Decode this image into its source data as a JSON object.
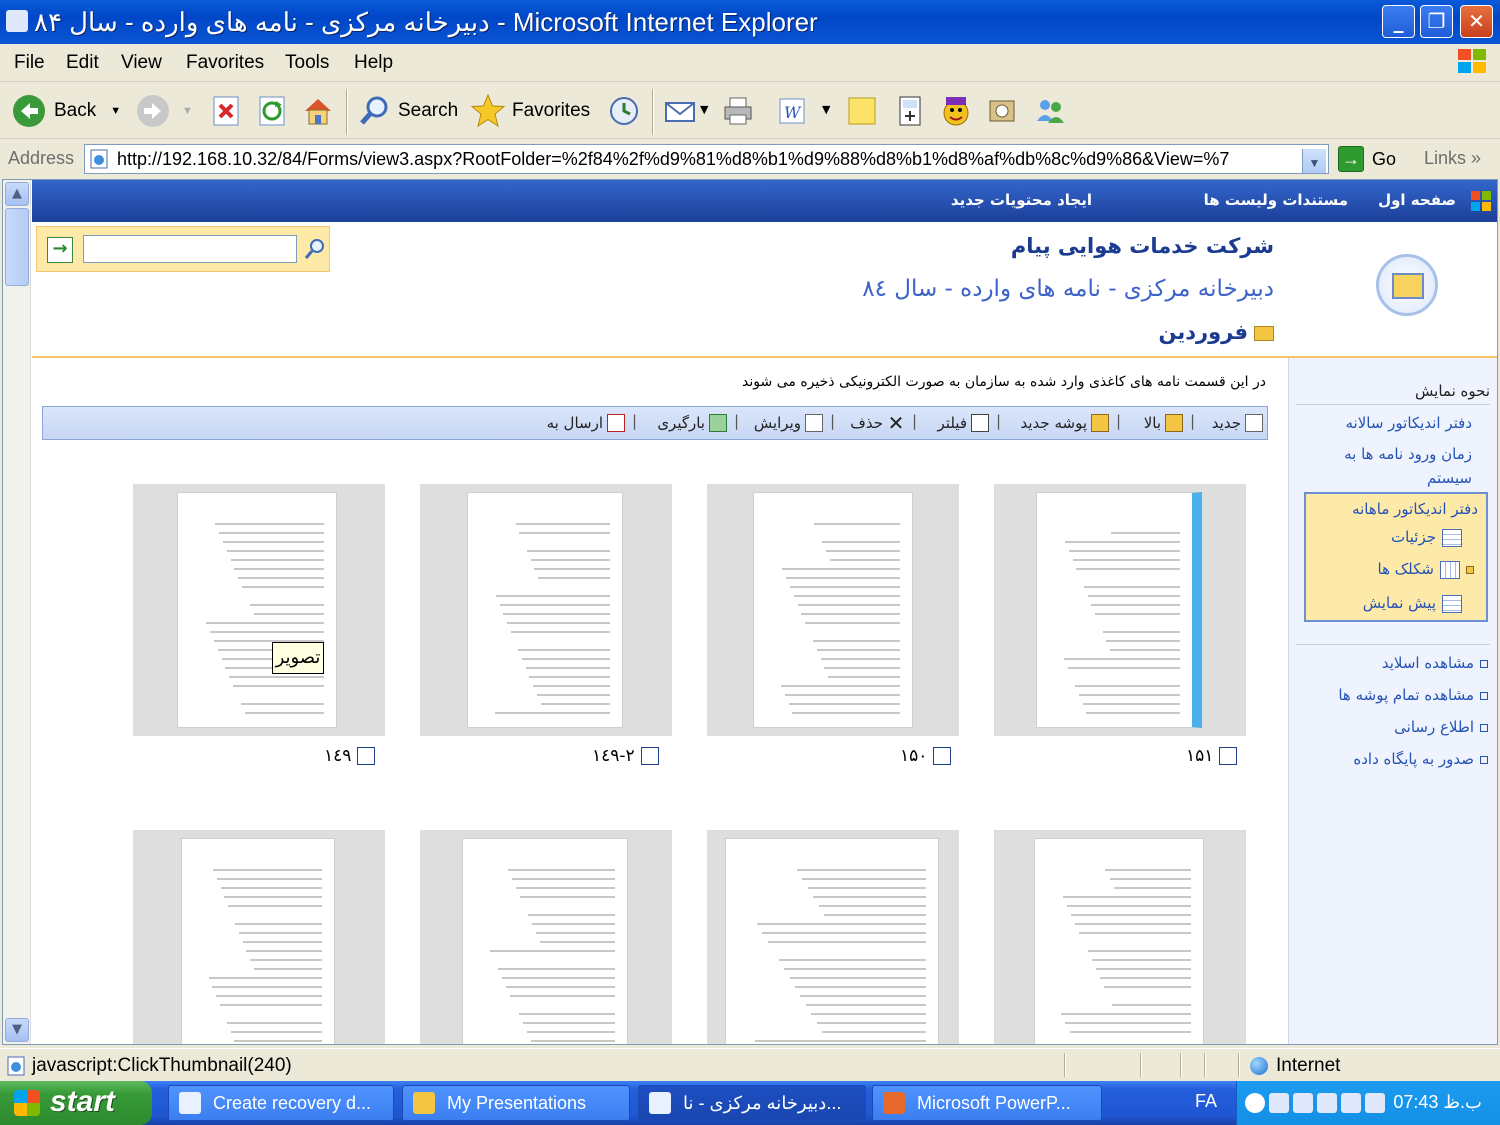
{
  "window": {
    "title": "دبیرخانه مرکزی - نامه های وارده - سال ۸۴ - Microsoft Internet Explorer",
    "controls": {
      "minimize": "_",
      "maximize": "❐",
      "close": "✕"
    }
  },
  "menu": [
    "File",
    "Edit",
    "View",
    "Favorites",
    "Tools",
    "Help"
  ],
  "toolbar": {
    "back": "Back",
    "search": "Search",
    "favorites": "Favorites"
  },
  "address": {
    "label": "Address",
    "url": "http://192.168.10.32/84/Forms/view3.aspx?RootFolder=%2f84%2f%d9%81%d8%b1%d9%88%d8%b1%d8%af%db%8c%d9%86&View=%7",
    "go": "Go",
    "links": "Links"
  },
  "nav": {
    "home": "صفحه اول",
    "docs": "مستندات ولیست ها",
    "create": "ایجاد محتویات جدید"
  },
  "header": {
    "site_title": "شرکت خدمات هوایی پیام",
    "list_title": "دبیرخانه مرکزی - نامه های وارده - سال ٨٤",
    "folder": "فروردین"
  },
  "sidebar": {
    "heading": "نحوه نمایش",
    "views": [
      "دفتر اندیکاتور سالانه",
      "زمان ورود نامه ها به سیستم"
    ],
    "selected_view": "دفتر اندیکاتور ماهانه",
    "view_modes": [
      "جزئیات",
      "شکلک ها",
      "پیش نمایش"
    ],
    "actions": [
      "مشاهده اسلاید",
      "مشاهده تمام پوشه ها",
      "اطلاع رسانی",
      "صدور به پایگاه داده"
    ]
  },
  "description": "در این قسمت نامه های کاغذی وارد شده به سازمان به صورت الکترونیکی ذخیره می شوند",
  "actions": [
    "جدید",
    "بالا",
    "پوشه جدید",
    "فیلتر",
    "حذف",
    "ویرایش",
    "بارگیری",
    "ارسال به"
  ],
  "thumbnails": {
    "row1": [
      "۱۵۱",
      "۱۵۰",
      "۱٤۹-۲",
      "۱٤۹"
    ],
    "tooltip": "تصویر"
  },
  "status": {
    "text": "javascript:ClickThumbnail(240)",
    "zone": "Internet"
  },
  "taskbar": {
    "start": "start",
    "tasks": [
      "Create recovery d...",
      "My Presentations",
      "دبیرخانه مرکزی - نا...",
      "Microsoft PowerP..."
    ],
    "lang": "FA",
    "clock": "07:43 ب.ظ"
  }
}
